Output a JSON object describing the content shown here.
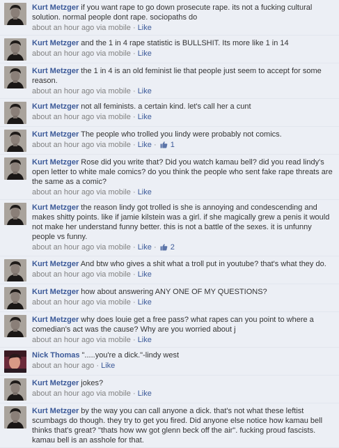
{
  "colors": {
    "background": "#eceff5",
    "link": "#3b5998",
    "meta": "#808080",
    "text": "#333333"
  },
  "comments": [
    {
      "author": "Kurt Metzger",
      "avatar": "kurt",
      "text": "if you want rape to go down prosecute rape. its not a fucking cultural solution. normal people dont rape. sociopaths do",
      "time": "about an hour ago via mobile",
      "like_label": "Like",
      "likes": ""
    },
    {
      "author": "Kurt Metzger",
      "avatar": "kurt",
      "text": "and the 1 in 4 rape statistic is BULLSHIT. Its more like 1 in 14",
      "time": "about an hour ago via mobile",
      "like_label": "Like",
      "likes": ""
    },
    {
      "author": "Kurt Metzger",
      "avatar": "kurt",
      "text": "the 1 in 4 is an old feminist lie that people just seem to accept for some reason.",
      "time": "about an hour ago via mobile",
      "like_label": "Like",
      "likes": ""
    },
    {
      "author": "Kurt Metzger",
      "avatar": "kurt",
      "text": "not all feminists. a certain kind. let's call her a cunt",
      "time": "about an hour ago via mobile",
      "like_label": "Like",
      "likes": ""
    },
    {
      "author": "Kurt Metzger",
      "avatar": "kurt",
      "text": "The people who trolled you lindy were probably not comics.",
      "time": "about an hour ago via mobile",
      "like_label": "Like",
      "likes": "1"
    },
    {
      "author": "Kurt Metzger",
      "avatar": "kurt",
      "text": "Rose did you write that? Did you watch kamau bell? did you read lindy's open letter to white male comics? do you think the people who sent fake rape threats are the same as a comic?",
      "time": "about an hour ago via mobile",
      "like_label": "Like",
      "likes": ""
    },
    {
      "author": "Kurt Metzger",
      "avatar": "kurt",
      "text": "the reason lindy got trolled is she is annoying and condescending and makes shitty points. like if jamie kilstein was a girl. if she magically grew a penis it would not make her understand funny better. this is not a battle of the sexes. it is unfunny people vs funny.",
      "time": "about an hour ago via mobile",
      "like_label": "Like",
      "likes": "2"
    },
    {
      "author": "Kurt Metzger",
      "avatar": "kurt",
      "text": "And btw who gives a shit what a troll put in youtube? that's what they do.",
      "time": "about an hour ago via mobile",
      "like_label": "Like",
      "likes": ""
    },
    {
      "author": "Kurt Metzger",
      "avatar": "kurt",
      "text": "how about answering ANY ONE OF MY QUESTIONS?",
      "time": "about an hour ago via mobile",
      "like_label": "Like",
      "likes": ""
    },
    {
      "author": "Kurt Metzger",
      "avatar": "kurt",
      "text": "why does louie get a free pass? what rapes can you point to where a comedian's act was the cause? Why are you worried about j",
      "time": "about an hour ago via mobile",
      "like_label": "Like",
      "likes": ""
    },
    {
      "author": "Nick Thomas",
      "avatar": "nick",
      "text": "\".....you're a dick.\"-lindy west",
      "time": "about an hour ago",
      "like_label": "Like",
      "likes": ""
    },
    {
      "author": "Kurt Metzger",
      "avatar": "kurt",
      "text": "jokes?",
      "time": "about an hour ago via mobile",
      "like_label": "Like",
      "likes": ""
    },
    {
      "author": "Kurt Metzger",
      "avatar": "kurt",
      "text": "by the way you can call anyone a dick. that's not what these leftist scumbags do though. they try to get you fired. Did anyone else notice how kamau bell thinks that's great? \"thats how ww got glenn beck off the air\". fucking proud fascists. kamau bell is an asshole for that.",
      "time": "",
      "like_label": "",
      "likes": ""
    }
  ]
}
